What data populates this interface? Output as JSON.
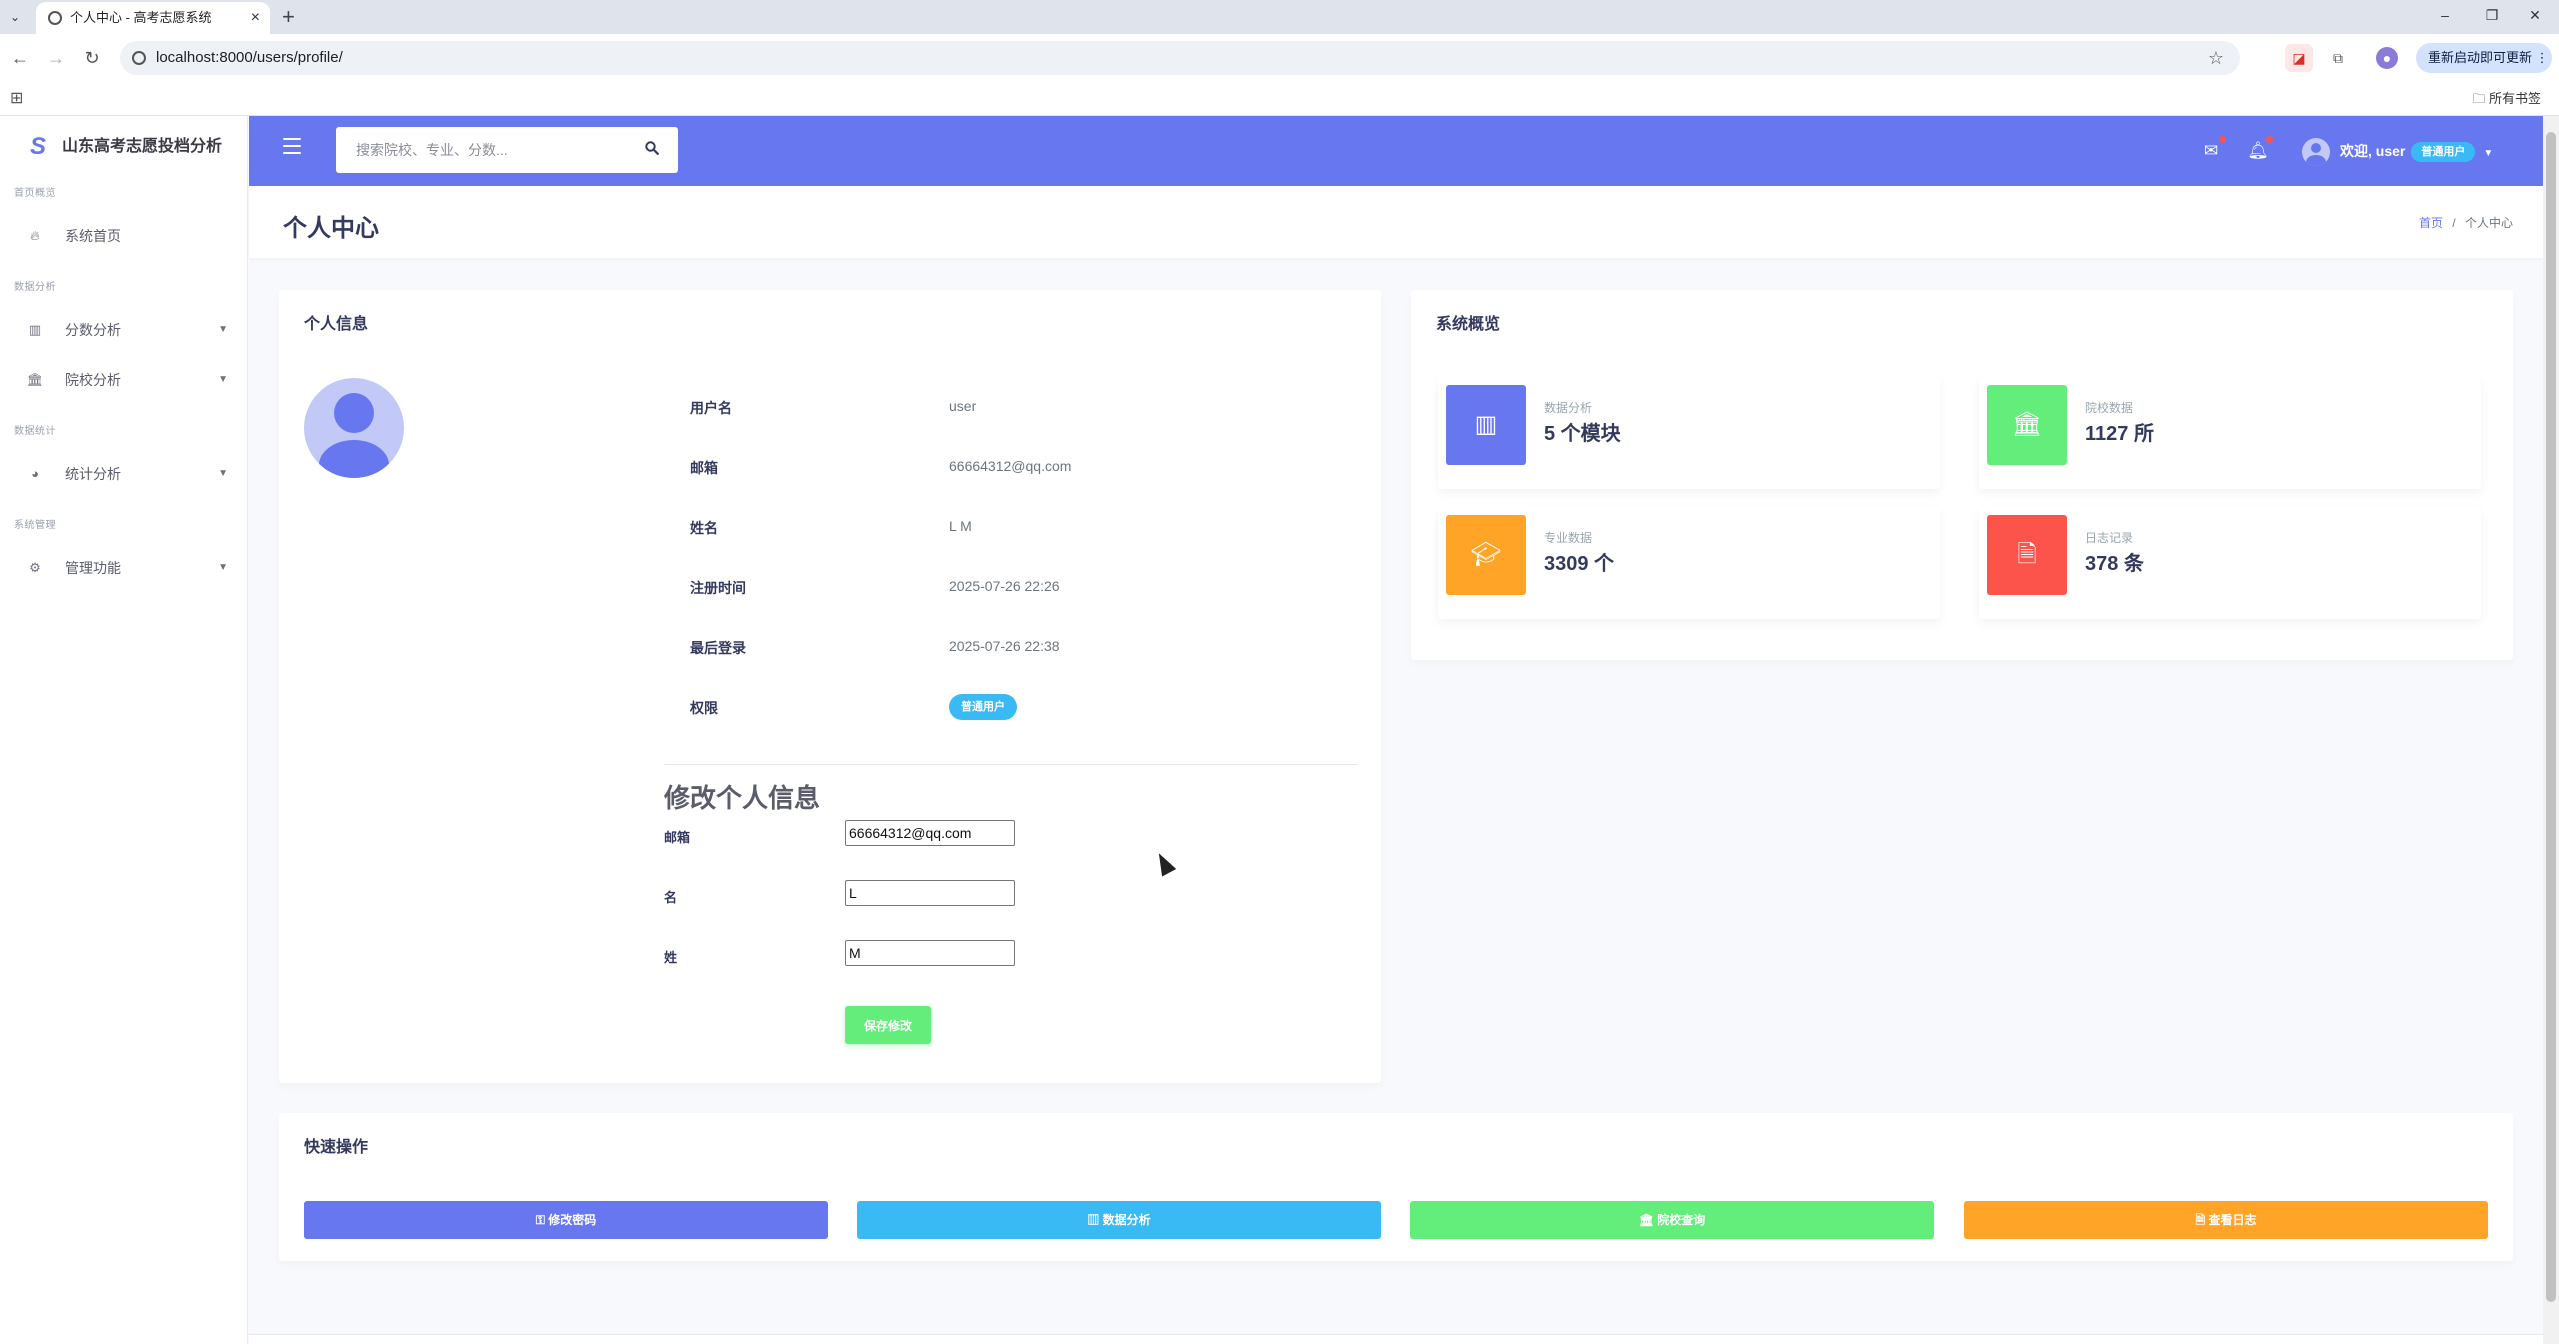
{
  "browser": {
    "tab_title": "个人中心 - 高考志愿系统",
    "url": "localhost:8000/users/profile/",
    "update_button": "重新启动即可更新",
    "all_bookmarks": "所有书签"
  },
  "sidebar": {
    "brand": "山东高考志愿投档分析",
    "brand_logo": "S",
    "sections": [
      {
        "heading": "首页概览",
        "items": [
          {
            "label": "系统首页",
            "icon": "fire-icon"
          }
        ]
      },
      {
        "heading": "数据分析",
        "items": [
          {
            "label": "分数分析",
            "icon": "chart-icon"
          },
          {
            "label": "院校分析",
            "icon": "university-icon"
          }
        ]
      },
      {
        "heading": "数据统计",
        "items": [
          {
            "label": "统计分析",
            "icon": "pie-icon"
          }
        ]
      },
      {
        "heading": "系统管理",
        "items": [
          {
            "label": "管理功能",
            "icon": "cogs-icon"
          }
        ]
      }
    ]
  },
  "navbar": {
    "search_placeholder": "搜索院校、专业、分数...",
    "welcome": "欢迎, user",
    "role_badge": "普通用户"
  },
  "page": {
    "title": "个人中心",
    "breadcrumb_home": "首页",
    "breadcrumb_sep": "/",
    "breadcrumb_current": "个人中心"
  },
  "profile": {
    "card_title": "个人信息",
    "fields": [
      {
        "label": "用户名",
        "value": "user"
      },
      {
        "label": "邮箱",
        "value": "66664312@qq.com"
      },
      {
        "label": "姓名",
        "value": "L M"
      },
      {
        "label": "注册时间",
        "value": "2025-07-26 22:26"
      },
      {
        "label": "最后登录",
        "value": "2025-07-26 22:38"
      }
    ],
    "permission_label": "权限",
    "permission_value": "普通用户",
    "edit_title": "修改个人信息",
    "form": [
      {
        "label": "邮箱",
        "value": "66664312@qq.com"
      },
      {
        "label": "名",
        "value": "L"
      },
      {
        "label": "姓",
        "value": "M"
      }
    ],
    "save_label": "保存修改"
  },
  "overview": {
    "card_title": "系统概览",
    "stats": [
      {
        "label": "数据分析",
        "value": "5 个模块",
        "color": "#6777ef",
        "icon": "bar-chart-icon"
      },
      {
        "label": "院校数据",
        "value": "1127 所",
        "color": "#63ed7a",
        "icon": "university-icon"
      },
      {
        "label": "专业数据",
        "value": "3309 个",
        "color": "#ffa426",
        "icon": "graduation-cap-icon"
      },
      {
        "label": "日志记录",
        "value": "378 条",
        "color": "#fc544b",
        "icon": "file-icon"
      }
    ]
  },
  "quick_actions": {
    "card_title": "快速操作",
    "buttons": [
      {
        "label": "修改密码",
        "color": "#6777ef",
        "icon": "key-icon"
      },
      {
        "label": "数据分析",
        "color": "#3abaf4",
        "icon": "bar-chart-icon"
      },
      {
        "label": "院校查询",
        "color": "#63ed7a",
        "icon": "university-icon"
      },
      {
        "label": "查看日志",
        "color": "#ffa426",
        "icon": "file-icon"
      }
    ]
  }
}
